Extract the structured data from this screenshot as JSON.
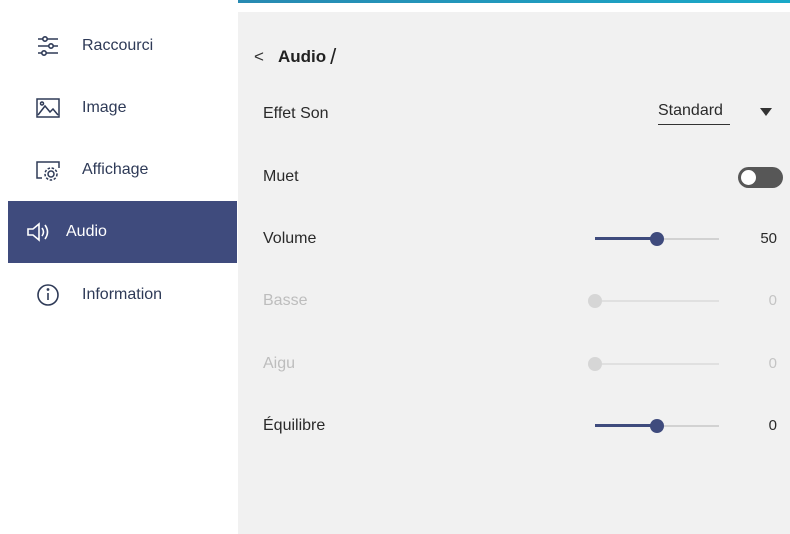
{
  "sidebar": {
    "items": [
      {
        "label": "Raccourci",
        "icon": "sliders-icon"
      },
      {
        "label": "Image",
        "icon": "image-icon"
      },
      {
        "label": "Affichage",
        "icon": "display-settings-icon"
      },
      {
        "label": "Audio",
        "icon": "speaker-icon",
        "active": true
      },
      {
        "label": "Information",
        "icon": "info-icon"
      }
    ]
  },
  "header": {
    "back_symbol": "<",
    "title": "Audio",
    "separator": "/"
  },
  "settings": {
    "sound_effect": {
      "label": "Effet Son",
      "value": "Standard"
    },
    "mute": {
      "label": "Muet",
      "on": false
    },
    "volume": {
      "label": "Volume",
      "value": "50",
      "level": 0.5
    },
    "bass": {
      "label": "Basse",
      "value": "0",
      "level": 0.0,
      "disabled": true
    },
    "treble": {
      "label": "Aigu",
      "value": "0",
      "level": 0.0,
      "disabled": true
    },
    "balance": {
      "label": "Équilibre",
      "value": "0",
      "level": 0.5
    }
  },
  "colors": {
    "accent": "#3f4b7d",
    "panel_bg": "#f1f1f1",
    "disabled_text": "#bdbdbd"
  }
}
